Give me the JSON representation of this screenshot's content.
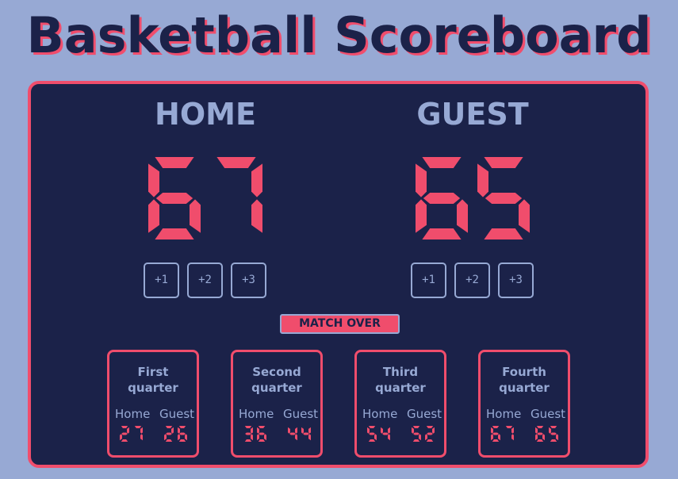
{
  "title": "Basketball Scoreboard",
  "home": {
    "name": "HOME",
    "score": "67",
    "buttons": [
      "+1",
      "+2",
      "+3"
    ]
  },
  "guest": {
    "name": "GUEST",
    "score": "65",
    "buttons": [
      "+1",
      "+2",
      "+3"
    ]
  },
  "status": "MATCH OVER",
  "quarters": [
    {
      "label_line1": "First",
      "label_line2": "quarter",
      "home_label": "Home",
      "guest_label": "Guest",
      "home": "27",
      "guest": "26"
    },
    {
      "label_line1": "Second",
      "label_line2": "quarter",
      "home_label": "Home",
      "guest_label": "Guest",
      "home": "36",
      "guest": "44"
    },
    {
      "label_line1": "Third",
      "label_line2": "quarter",
      "home_label": "Home",
      "guest_label": "Guest",
      "home": "54",
      "guest": "52"
    },
    {
      "label_line1": "Fourth",
      "label_line2": "quarter",
      "home_label": "Home",
      "guest_label": "Guest",
      "home": "67",
      "guest": "65"
    }
  ],
  "colors": {
    "background": "#97a9d4",
    "board": "#1b2249",
    "accent": "#f04d6c",
    "muted": "#97a9d4"
  }
}
